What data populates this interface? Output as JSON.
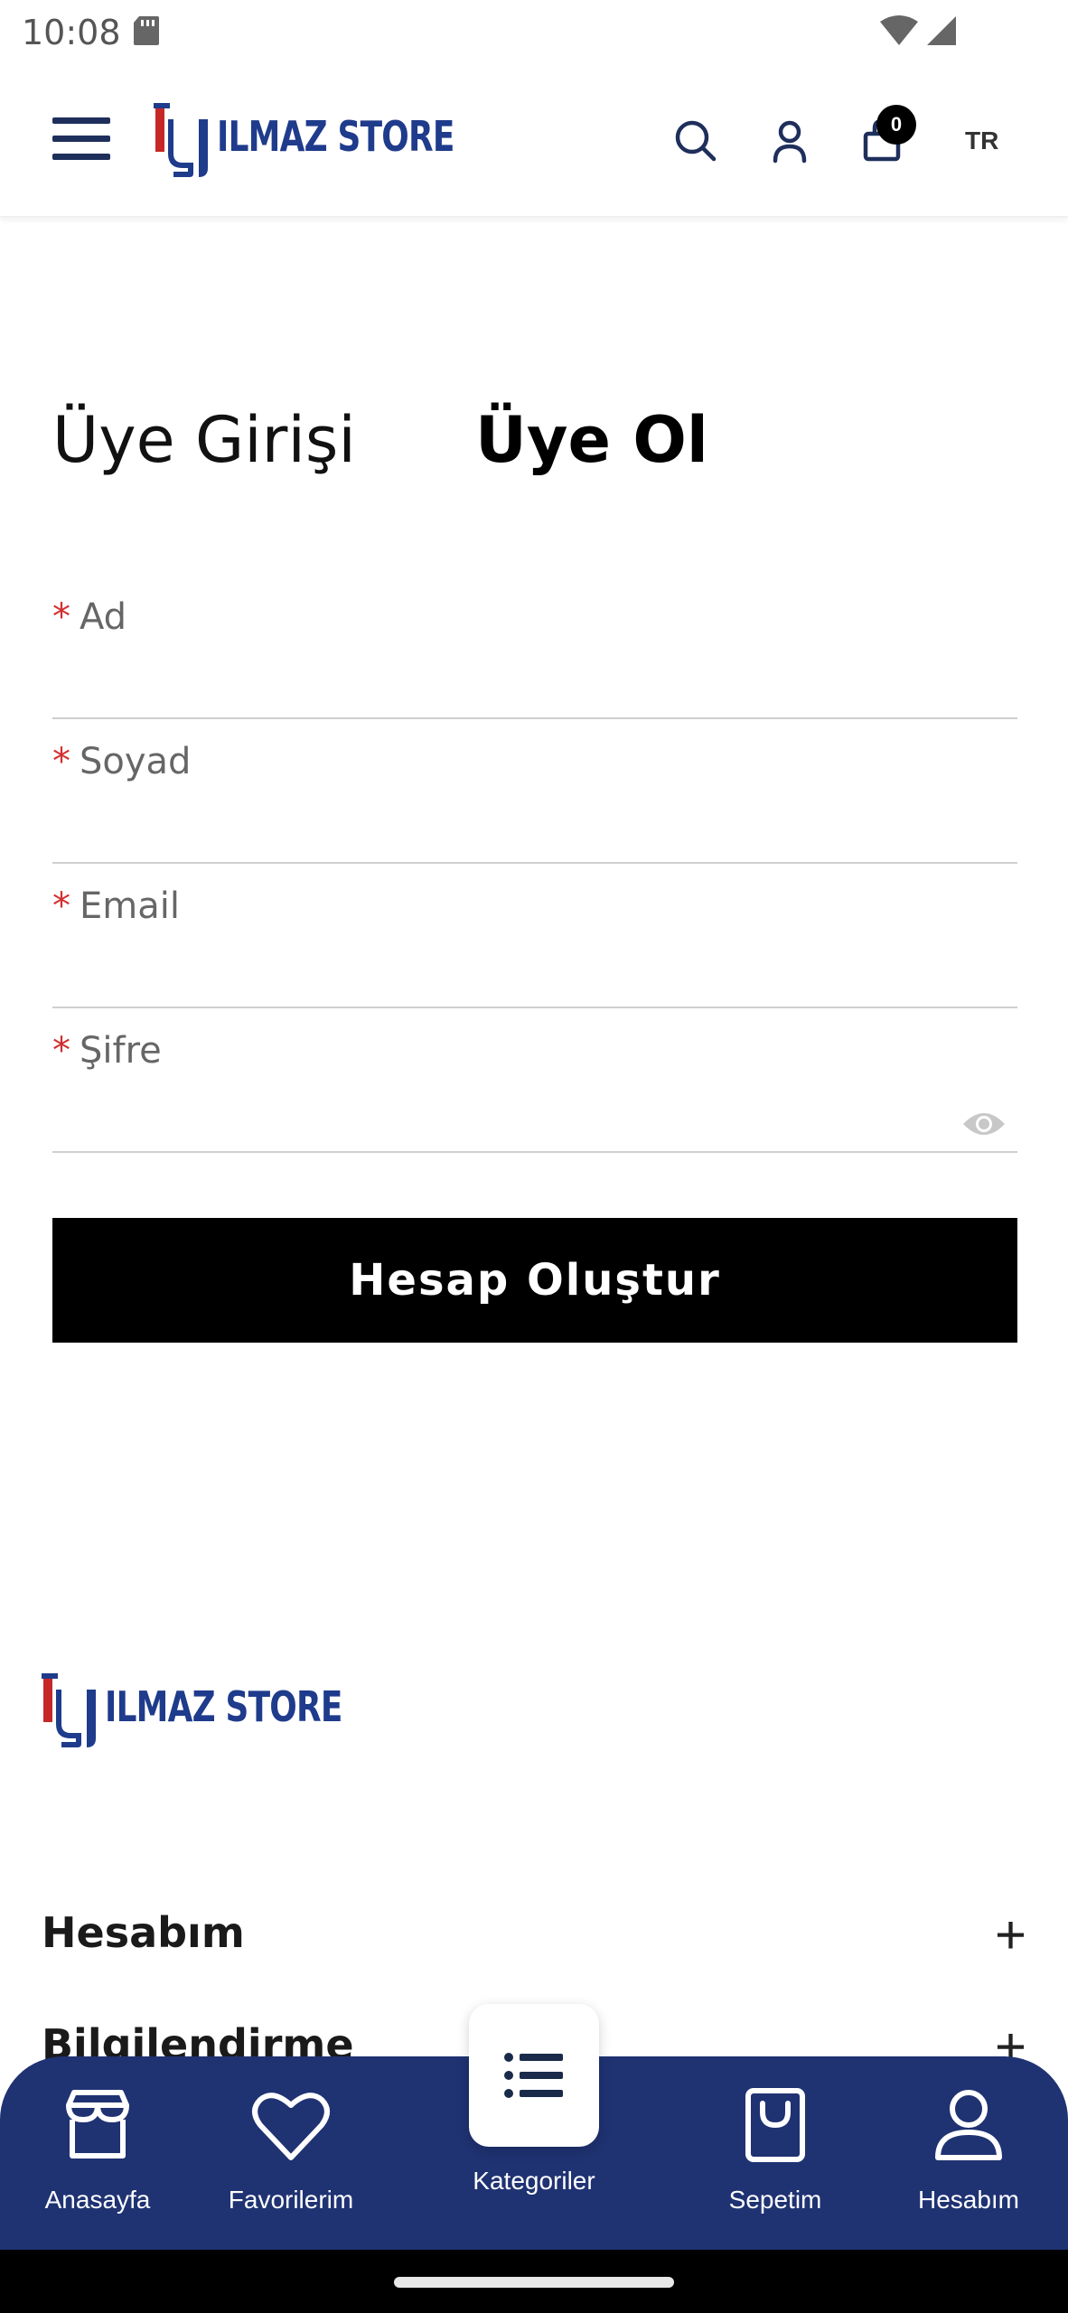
{
  "status_bar": {
    "time": "10:08"
  },
  "header": {
    "logo_text": "ILMAZ STORE",
    "cart_count": "0",
    "language": "TR"
  },
  "tabs": {
    "login": "Üye Girişi",
    "register": "Üye Ol"
  },
  "form": {
    "required_mark": "*",
    "fields": [
      {
        "label": "Ad",
        "value": ""
      },
      {
        "label": "Soyad",
        "value": ""
      },
      {
        "label": "Email",
        "value": ""
      },
      {
        "label": "Şifre",
        "value": ""
      }
    ],
    "submit_label": "Hesap Oluştur"
  },
  "footer": {
    "logo_text": "ILMAZ STORE",
    "sections": [
      {
        "title": "Hesabım",
        "toggle": "+"
      },
      {
        "title": "Bilgilendirme",
        "toggle": "+"
      }
    ]
  },
  "bottom_nav": {
    "items": [
      {
        "label": "Anasayfa",
        "icon": "store-icon"
      },
      {
        "label": "Favorilerim",
        "icon": "heart-icon"
      },
      {
        "label": "Kategoriler",
        "icon": "list-icon"
      },
      {
        "label": "Sepetim",
        "icon": "bag-icon"
      },
      {
        "label": "Hesabım",
        "icon": "user-icon"
      }
    ]
  },
  "colors": {
    "brand_blue": "#1f3272",
    "logo_blue": "#1f3b8c",
    "required_red": "#d32f2f",
    "button_black": "#000000"
  }
}
